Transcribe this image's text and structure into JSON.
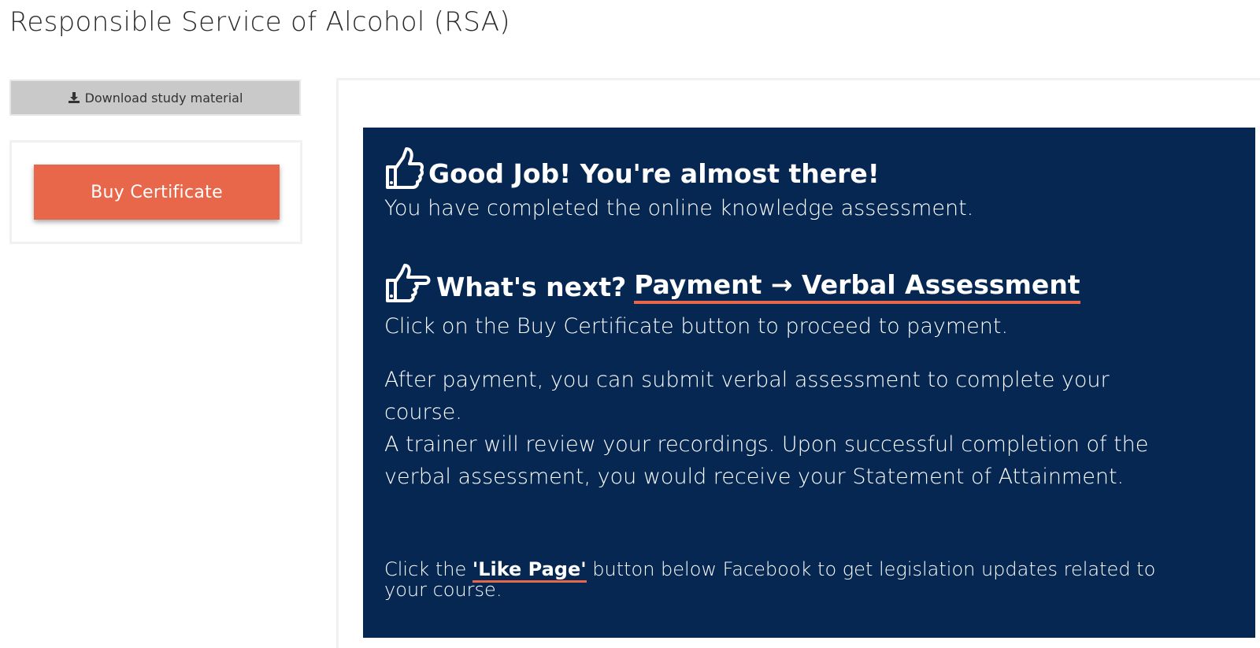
{
  "page": {
    "title": "Responsible Service of Alcohol (RSA)"
  },
  "sidebar": {
    "download_label": "Download study material",
    "download_icon": "download-icon",
    "buy_label": "Buy Certificate"
  },
  "message": {
    "heading1": "Good Job! You're almost there!",
    "heading1_icon": "thumbs-up-icon",
    "line1": "You have completed the online knowledge assessment.",
    "heading2_prefix": "What's next?",
    "heading2_steps": "Payment → Verbal Assessment",
    "heading2_icon": "hand-pointing-icon",
    "line2": "Click on the Buy Certificate button to proceed to payment.",
    "para_line1": "After payment, you can submit verbal assessment to complete your",
    "para_line2": "course.",
    "para_line3": "A trainer will review your recordings. Upon successful completion of the",
    "para_line4": "verbal assessment, you would receive your Statement of Attainment.",
    "footer_prefix": "Click the",
    "footer_link": "'Like Page'",
    "footer_suffix": "button below Facebook to get legislation updates related to",
    "footer_line2": "your course."
  },
  "colors": {
    "panel_bg": "#062751",
    "accent": "#e8674a",
    "download_bg": "#c9c9c9"
  }
}
